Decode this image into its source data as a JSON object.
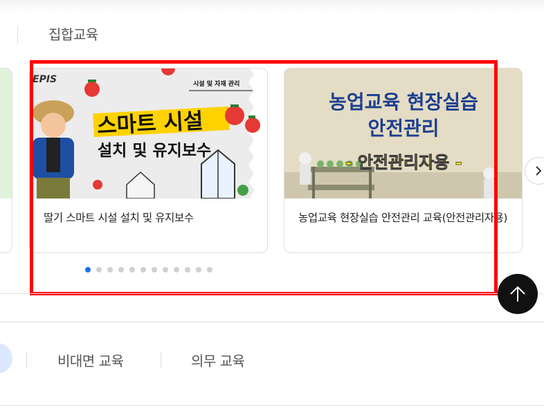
{
  "header": {
    "section_title": "집합교육"
  },
  "cards": [
    {
      "title": "딸기 스마트 시설 설치 및 유지보수",
      "thumb": {
        "logo": "EPIS",
        "corner_tag": "시설 및 자재 관리",
        "headline": "스마트 시설",
        "subline": "설치 및 유지보수"
      }
    },
    {
      "title": "농업교육 현장실습 안전관리 교육(안전관리자용)",
      "thumb": {
        "line1": "농업교육 현장실습",
        "line2": "안전관리",
        "line3": "- 안전관리자용 -"
      }
    }
  ],
  "pagination": {
    "count": 12,
    "active_index": 0
  },
  "bottom_tabs": {
    "tab1": "비대면 교육",
    "tab2": "의무 교육"
  },
  "icons": {
    "next": "chevron-right-icon",
    "top": "arrow-up-icon"
  },
  "colors": {
    "highlight_box": "#ff0000",
    "active_dot": "#1a73e8",
    "top_button": "#111111"
  }
}
